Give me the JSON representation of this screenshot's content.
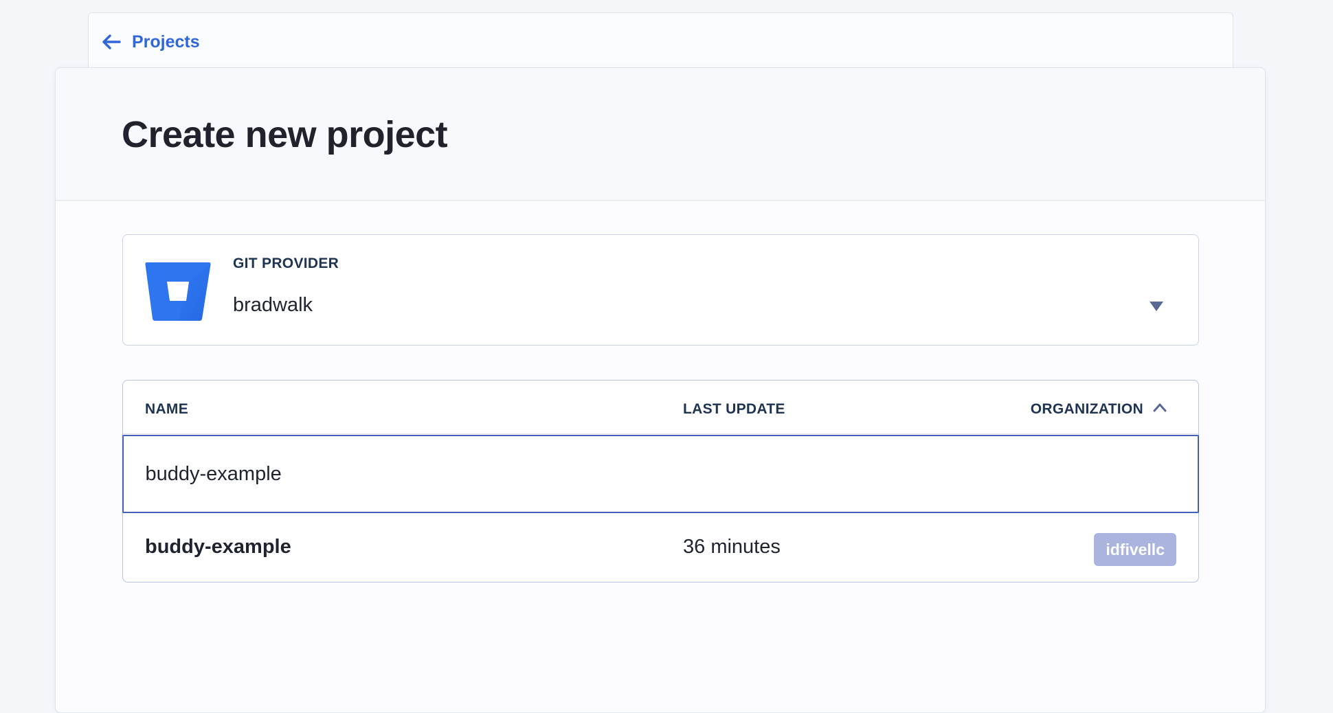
{
  "nav": {
    "back_label": "Projects"
  },
  "page": {
    "title": "Create new project"
  },
  "git_provider": {
    "label": "GIT PROVIDER",
    "selected_value": "bradwalk",
    "logo_icon": "bitbucket-icon"
  },
  "repo_table": {
    "columns": {
      "name": "NAME",
      "last_update": "LAST UPDATE",
      "organization": "ORGANIZATION"
    },
    "search": {
      "value": "buddy-example",
      "placeholder": ""
    },
    "rows": [
      {
        "name": "buddy-example",
        "last_update": "36 minutes",
        "organization": "idfivellc"
      }
    ]
  },
  "colors": {
    "link": "#2f66d8",
    "bitbucket_blue": "#2e75f0",
    "badge": "#aab4de",
    "focus_border": "#4460b8"
  }
}
